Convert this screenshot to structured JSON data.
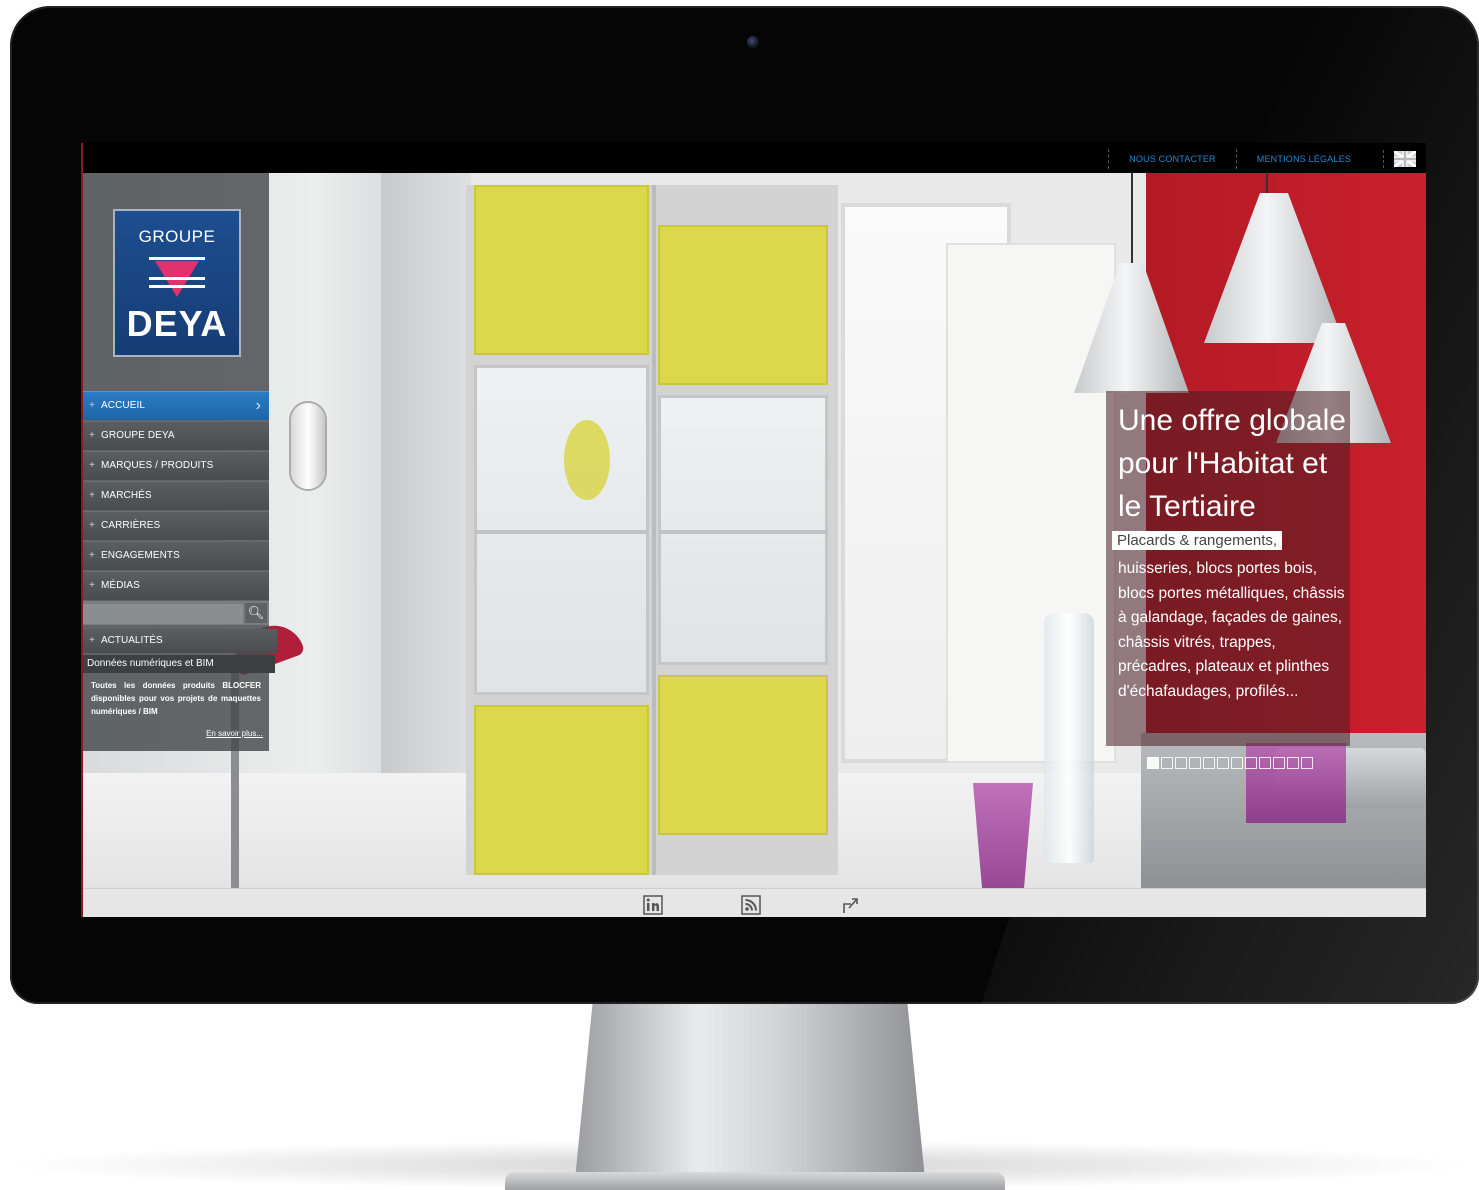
{
  "header": {
    "links": [
      "NOUS CONTACTER",
      "MENTIONS LÉGALES"
    ],
    "language_flag": "uk-flag-icon"
  },
  "logo": {
    "line1": "GROUPE",
    "line2": "DEYA"
  },
  "menu": {
    "items": [
      {
        "label": "ACCUEIL",
        "active": true
      },
      {
        "label": "GROUPE DEYA",
        "active": false
      },
      {
        "label": "MARQUES / PRODUITS",
        "active": false
      },
      {
        "label": "MARCHÉS",
        "active": false
      },
      {
        "label": "CARRIÈRES",
        "active": false
      },
      {
        "label": "ENGAGEMENTS",
        "active": false
      },
      {
        "label": "MÉDIAS",
        "active": false
      }
    ]
  },
  "search": {
    "value": "",
    "icon": "search-icon"
  },
  "news": {
    "heading": "ACTUALITÉS",
    "subheading": "Données numériques et BIM",
    "body": "Toutes les données produits BLOCFER disponibles pour vos projets de maquettes numériques / BIM",
    "more": "En savoir plus..."
  },
  "hero": {
    "title": "Une offre globale pour l'Habitat et le Tertiaire",
    "highlight": "Placards & rangements,",
    "body": "huisseries, blocs portes bois, blocs portes métalliques, châssis à galandage, façades de gaines, châssis vitrés, trappes, précadres, plateaux et plinthes d'échafaudages, profilés...",
    "slides": 12,
    "active_slide": 1
  },
  "footer": {
    "icons": [
      "linkedin-icon",
      "rss-icon",
      "share-icon"
    ]
  },
  "colors": {
    "accent": "#1e8ad0",
    "menu_active": "#2b7cc4",
    "logo_blue": "#1d4e90",
    "logo_pink": "#e0336e",
    "wall_red": "#c9202c",
    "door_yellow": "#dcd84a"
  }
}
